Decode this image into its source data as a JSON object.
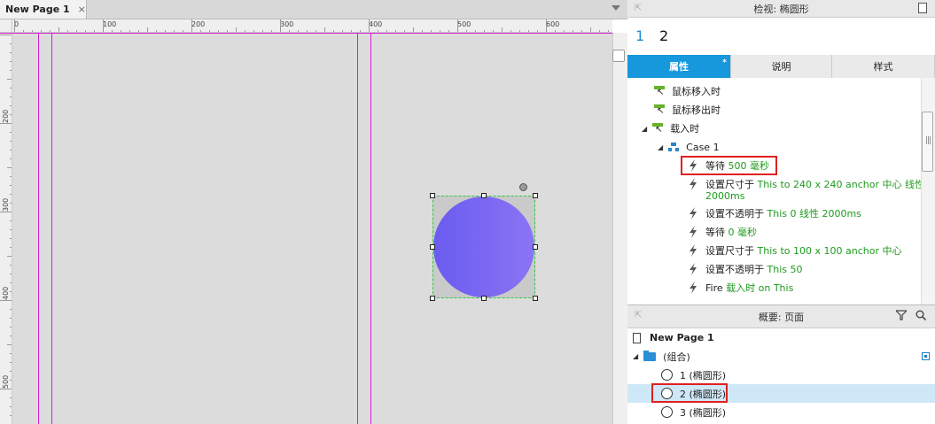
{
  "tabs": {
    "page_title": "New Page 1",
    "close_symbol": "×"
  },
  "ruler": {
    "top_labels": [
      "0",
      "100",
      "200",
      "300",
      "400",
      "500",
      "600"
    ],
    "left_labels": [
      "200",
      "300",
      "400",
      "500"
    ]
  },
  "inspector": {
    "title": "检视: 椭圆形",
    "name_number": "1",
    "name_value": "2",
    "tabs": [
      {
        "label": "属性",
        "marker": "*"
      },
      {
        "label": "说明"
      },
      {
        "label": "样式"
      }
    ],
    "interactions": [
      {
        "event": "鼠标移入时"
      },
      {
        "event": "鼠标移出时"
      },
      {
        "event": "载入时"
      },
      {
        "case": "Case 1"
      }
    ],
    "actions": [
      {
        "label": "等待",
        "detail": "500 毫秒"
      },
      {
        "label": "设置尺寸于",
        "detail": "This to 240 x 240 anchor 中心 线性",
        "detail2": "2000ms"
      },
      {
        "label": "设置不透明于",
        "detail": "This 0 线性 2000ms"
      },
      {
        "label": "等待",
        "detail": "0 毫秒"
      },
      {
        "label": "设置尺寸于",
        "detail": "This to 100 x 100 anchor 中心"
      },
      {
        "label": "设置不透明于",
        "detail": "This 50"
      },
      {
        "label": "Fire",
        "detail": "载入时 on This"
      }
    ]
  },
  "overview": {
    "title": "概要: 页面",
    "page": "New Page 1",
    "group": "(组合)",
    "items": [
      "1 (椭圆形)",
      "2 (椭圆形)",
      "3 (椭圆形)"
    ]
  },
  "colors": {
    "accent": "#1797dc",
    "guide": "#d21fd2",
    "ellipse_from": "#6a5cf0",
    "ellipse_to": "#8b74f4",
    "highlight_box": "#e02020",
    "selected_row": "#cfe8f7",
    "action_value": "#1f9a1f"
  },
  "icons": [
    "pin-icon",
    "page-icon",
    "lightning-icon",
    "event-icon",
    "case-icon",
    "filter-icon",
    "search-icon",
    "folder-icon",
    "ellipse-icon",
    "checkbox-icon",
    "dropdown-arrow-icon"
  ]
}
